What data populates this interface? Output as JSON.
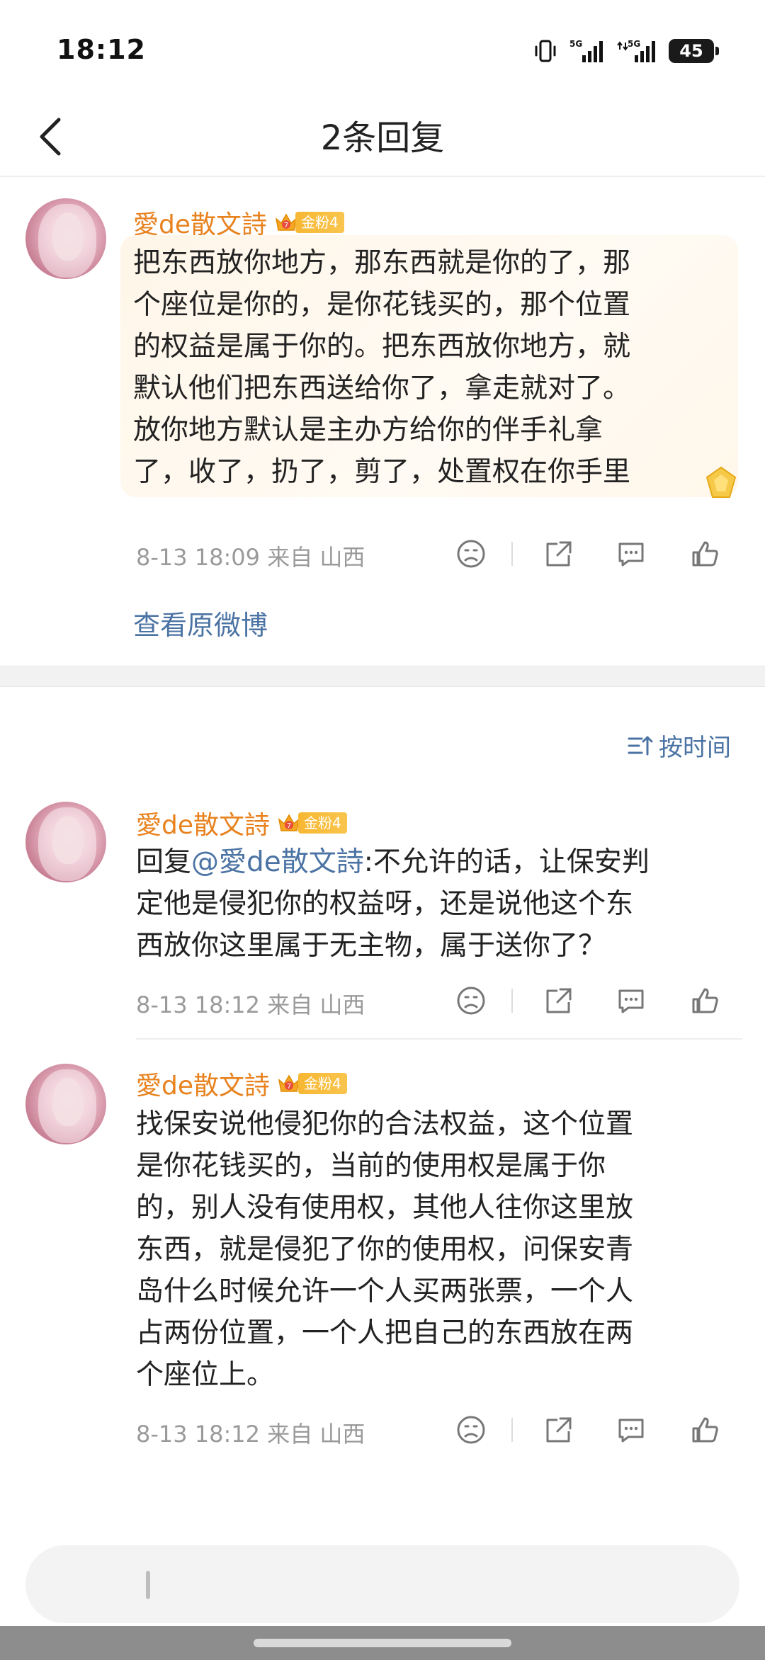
{
  "status_bar": {
    "time": "18:12",
    "battery": "45",
    "net1": "5G",
    "net2": "5G"
  },
  "nav": {
    "title": "2条回复"
  },
  "original_comment": {
    "username": "愛de散文詩",
    "badge_level": "7",
    "badge_label": "金粉4",
    "lines": [
      "把东西放你地方，那东西就是你的了，那",
      "个座位是你的，是你花钱买的，那个位置",
      "的权益是属于你的。把东西放你地方，就",
      "默认他们把东西送给你了，拿走就对了。",
      "放你地方默认是主办方给你的伴手礼拿",
      "了，收了，扔了，剪了，处置权在你手里"
    ],
    "meta": "8-13 18:09  来自 山西"
  },
  "view_original_label": "查看原微博",
  "sort_label": "按时间",
  "replies": [
    {
      "username": "愛de散文詩",
      "badge_level": "7",
      "badge_label": "金粉4",
      "reply_prefix": "回复",
      "mention": "@愛de散文詩",
      "line1_rest": ":不允许的话，让保安判",
      "lines": [
        "定他是侵犯你的权益呀，还是说他这个东",
        "西放你这里属于无主物，属于送你了？"
      ],
      "meta": "8-13 18:12  来自 山西"
    },
    {
      "username": "愛de散文詩",
      "badge_level": "7",
      "badge_label": "金粉4",
      "lines": [
        "找保安说他侵犯你的合法权益，这个位置",
        "是你花钱买的，当前的使用权是属于你",
        "的，别人没有使用权，其他人往你这里放",
        "东西，就是侵犯了你的使用权，问保安青",
        "岛什么时候允许一个人买两张票，一个人",
        "占两份位置，一个人把自己的东西放在两",
        "个座位上。"
      ],
      "meta": "8-13 18:12  来自 山西"
    }
  ],
  "icons": {
    "back": "chevron-left-icon",
    "dislike": "sad-face-icon",
    "share": "share-icon",
    "comment": "comment-icon",
    "like": "thumbs-up-icon"
  },
  "colors": {
    "username": "#e8821f",
    "link": "#4b73a3",
    "meta": "#9a9a9a"
  }
}
